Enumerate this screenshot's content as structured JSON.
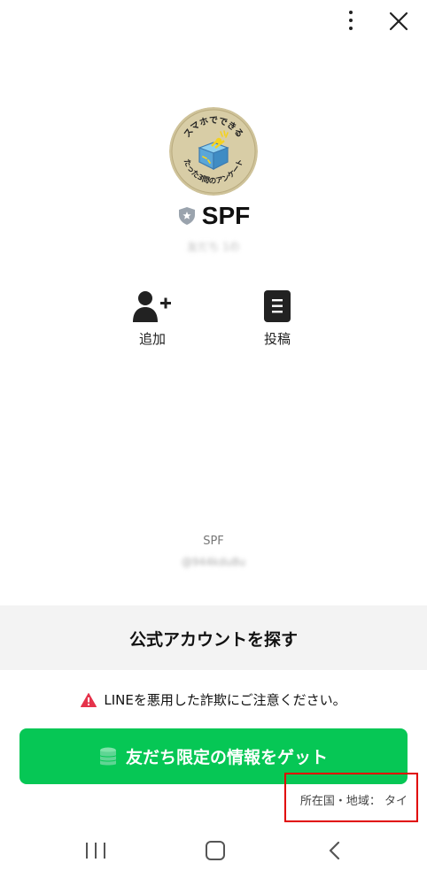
{
  "account": {
    "name": "SPF",
    "friends_count": "友だち 1の",
    "badge_icon": "shield-star-icon",
    "avatar_text_top": "スマホでできる",
    "avatar_text_bottom": "たった3問のアンケート"
  },
  "actions": [
    {
      "label": "追加",
      "icon": "add-friend-icon"
    },
    {
      "label": "投稿",
      "icon": "post-icon"
    }
  ],
  "footer": {
    "name": "SPF",
    "line_id": "@944kdu8u"
  },
  "find_section": {
    "title": "公式アカウントを探す"
  },
  "warning": {
    "text": "LINEを悪用した詐欺にご注意ください。",
    "icon": "warning-icon"
  },
  "cta": {
    "label": "友だち限定の情報をゲット",
    "icon": "coins-icon"
  },
  "region": {
    "text": "所在国・地域： タイ"
  },
  "colors": {
    "brand_green": "#06c755",
    "warning_red": "#e5334b",
    "highlight_red": "#e00000"
  }
}
